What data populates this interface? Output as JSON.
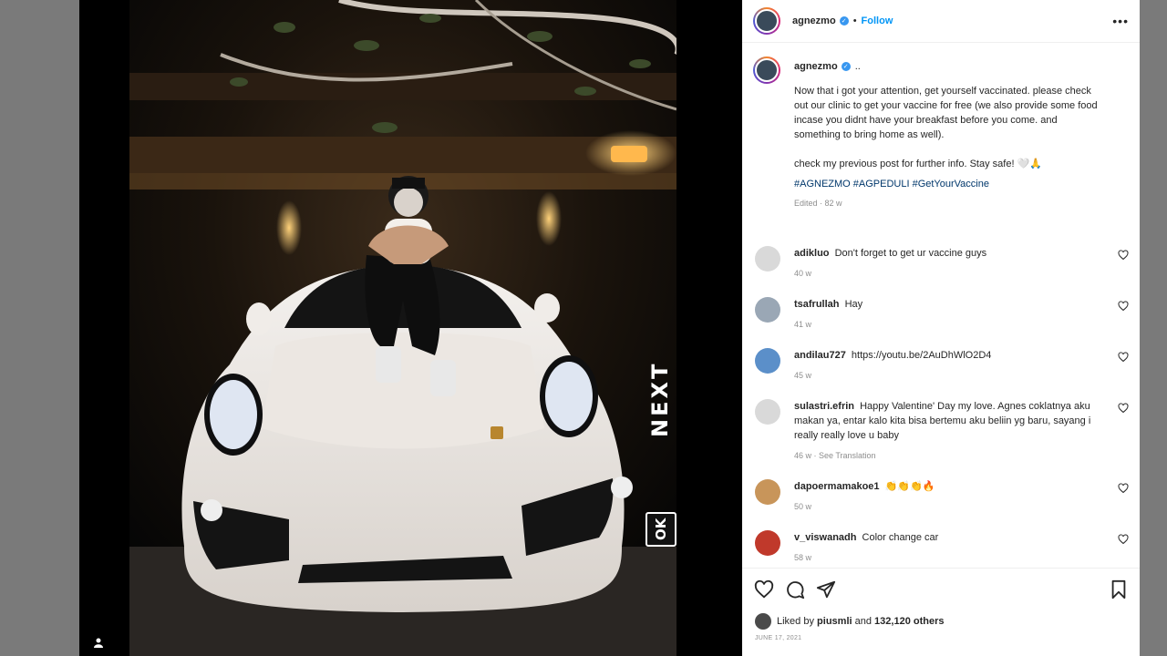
{
  "post": {
    "author": "agnezmo",
    "follow_label": "Follow",
    "dot": "•",
    "more_icon": "more-horizontal-icon",
    "overlay_next": "NEXT",
    "overlay_ok": "OK",
    "caption_ellipsis": "..",
    "caption": "Now that i got your attention, get yourself vaccinated. please check out our clinic to get your vaccine for free (we also provide some food incase you didnt have your breakfast before you come. and something to bring home as well).\n\ncheck my previous post for further info. Stay safe! 🤍🙏",
    "hashtags": "#AGNEZMO #AGPEDULI #GetYourVaccine",
    "caption_meta": "Edited · 82 w"
  },
  "comments": [
    {
      "user": "adikluo",
      "text": "Don't forget to get ur vaccine guys",
      "meta": "40 w",
      "avatar_color": "#d9d9d9"
    },
    {
      "user": "tsafrullah",
      "text": "Hay",
      "meta": "41 w",
      "avatar_color": "#9aa7b5"
    },
    {
      "user": "andilau727",
      "text": "https://youtu.be/2AuDhWlO2D4",
      "meta": "45 w",
      "avatar_color": "#5b8fc9"
    },
    {
      "user": "sulastri.efrin",
      "text": "Happy Valentine' Day my love. Agnes coklatnya aku makan ya, entar kalo kita bisa bertemu aku beliin yg baru, sayang i really really love u baby",
      "meta": "46 w · See Translation",
      "avatar_color": "#d9d9d9"
    },
    {
      "user": "dapoermamakoe1",
      "text": "👏👏👏🔥",
      "meta": "50 w",
      "avatar_color": "#c8955a"
    },
    {
      "user": "v_viswanadh",
      "text": "Color change car",
      "meta": "58 w",
      "avatar_color": "#c0392b"
    }
  ],
  "likes": {
    "prefix": "Liked by",
    "first_user": "piusmli",
    "joiner": "and",
    "others": "132,120 others"
  },
  "date": "JUNE 17, 2021",
  "colors": {
    "accent": "#0095f6",
    "verified": "#3897f0",
    "hashtag": "#00376b"
  }
}
